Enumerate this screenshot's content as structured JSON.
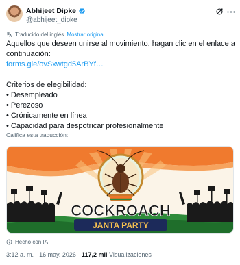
{
  "tweet": {
    "author_name": "Abhijeet Dipke",
    "author_handle": "@abhijeet_dipke",
    "translated_from": "Traducido del inglés",
    "show_original": "Mostrar original",
    "text_lines": [
      "Aquellos que deseen unirse al movimiento, hagan clic en el enlace a",
      "continuación:"
    ],
    "link": "forms.gle/ovSxwtgd5ArBYf…",
    "criteria_title": "Criterios de elegibilidad:",
    "criteria": [
      "• Desempleado",
      "• Perezoso",
      "• Crónicamente en línea",
      "• Capacidad para despotricar profesionalmente"
    ],
    "rate_translation": "Califica esta traducción:",
    "image_title": "COCKROACH",
    "image_subtitle": "JANTA PARTY",
    "ai_label": "Hecho con IA",
    "time": "3:12 a. m.",
    "separator": "·",
    "date": "16 may. 2026",
    "views_count": "117,2 mil",
    "views_label": "Visualizaciones"
  },
  "colors": {
    "link": "#1d9bf0",
    "secondary_text": "#536471",
    "saffron": "#f0762a",
    "green": "#2e8b3a",
    "navy": "#1c2a5a"
  }
}
